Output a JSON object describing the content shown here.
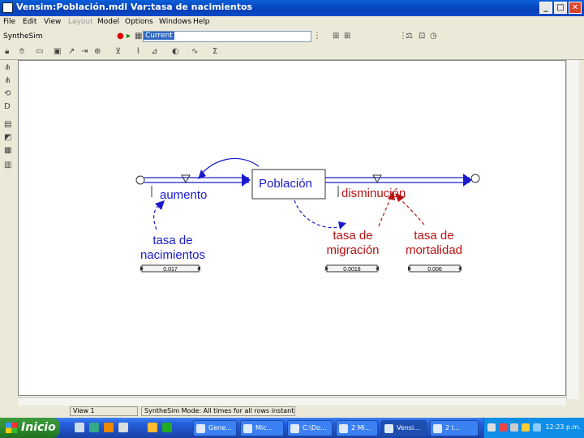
{
  "window": {
    "title": "Vensim:Población.mdl Var:tasa de nacimientos",
    "minimize": "_",
    "maximize": "□",
    "close": "✕"
  },
  "menu": [
    {
      "label": "File",
      "enabled": true
    },
    {
      "label": "Edit",
      "enabled": true
    },
    {
      "label": "View",
      "enabled": true
    },
    {
      "label": "Layout",
      "enabled": false
    },
    {
      "label": "Model",
      "enabled": true
    },
    {
      "label": "Options",
      "enabled": true
    },
    {
      "label": "Windows",
      "enabled": true
    },
    {
      "label": "Help",
      "enabled": true
    }
  ],
  "toolbar": {
    "synthesim_label": "SyntheSim",
    "run_name": "Current"
  },
  "diagram": {
    "stock": "Población",
    "inflow": "aumento",
    "outflow": "disminución",
    "birth_rate": {
      "line1": "tasa de",
      "line2": "nacimientos",
      "value": "0.017"
    },
    "migration_rate": {
      "line1": "tasa de",
      "line2": "migración",
      "value": "0.0018"
    },
    "mortality_rate": {
      "line1": "tasa de",
      "line2": "mortalidad",
      "value": "0.006"
    },
    "colors": {
      "blue": "#1a1acc",
      "red": "#bb1111",
      "dark": "#333333"
    }
  },
  "status": {
    "view": "View 1",
    "message": "SyntheSim Mode: All times for all rows instantly"
  },
  "taskbar": {
    "start": "Inicio",
    "tasks": [
      "Gene...",
      "Mic...",
      "C:\\Do...",
      "2 Mi...",
      "Vensi...",
      "2 I..."
    ],
    "clock": "12:23 p.m."
  }
}
